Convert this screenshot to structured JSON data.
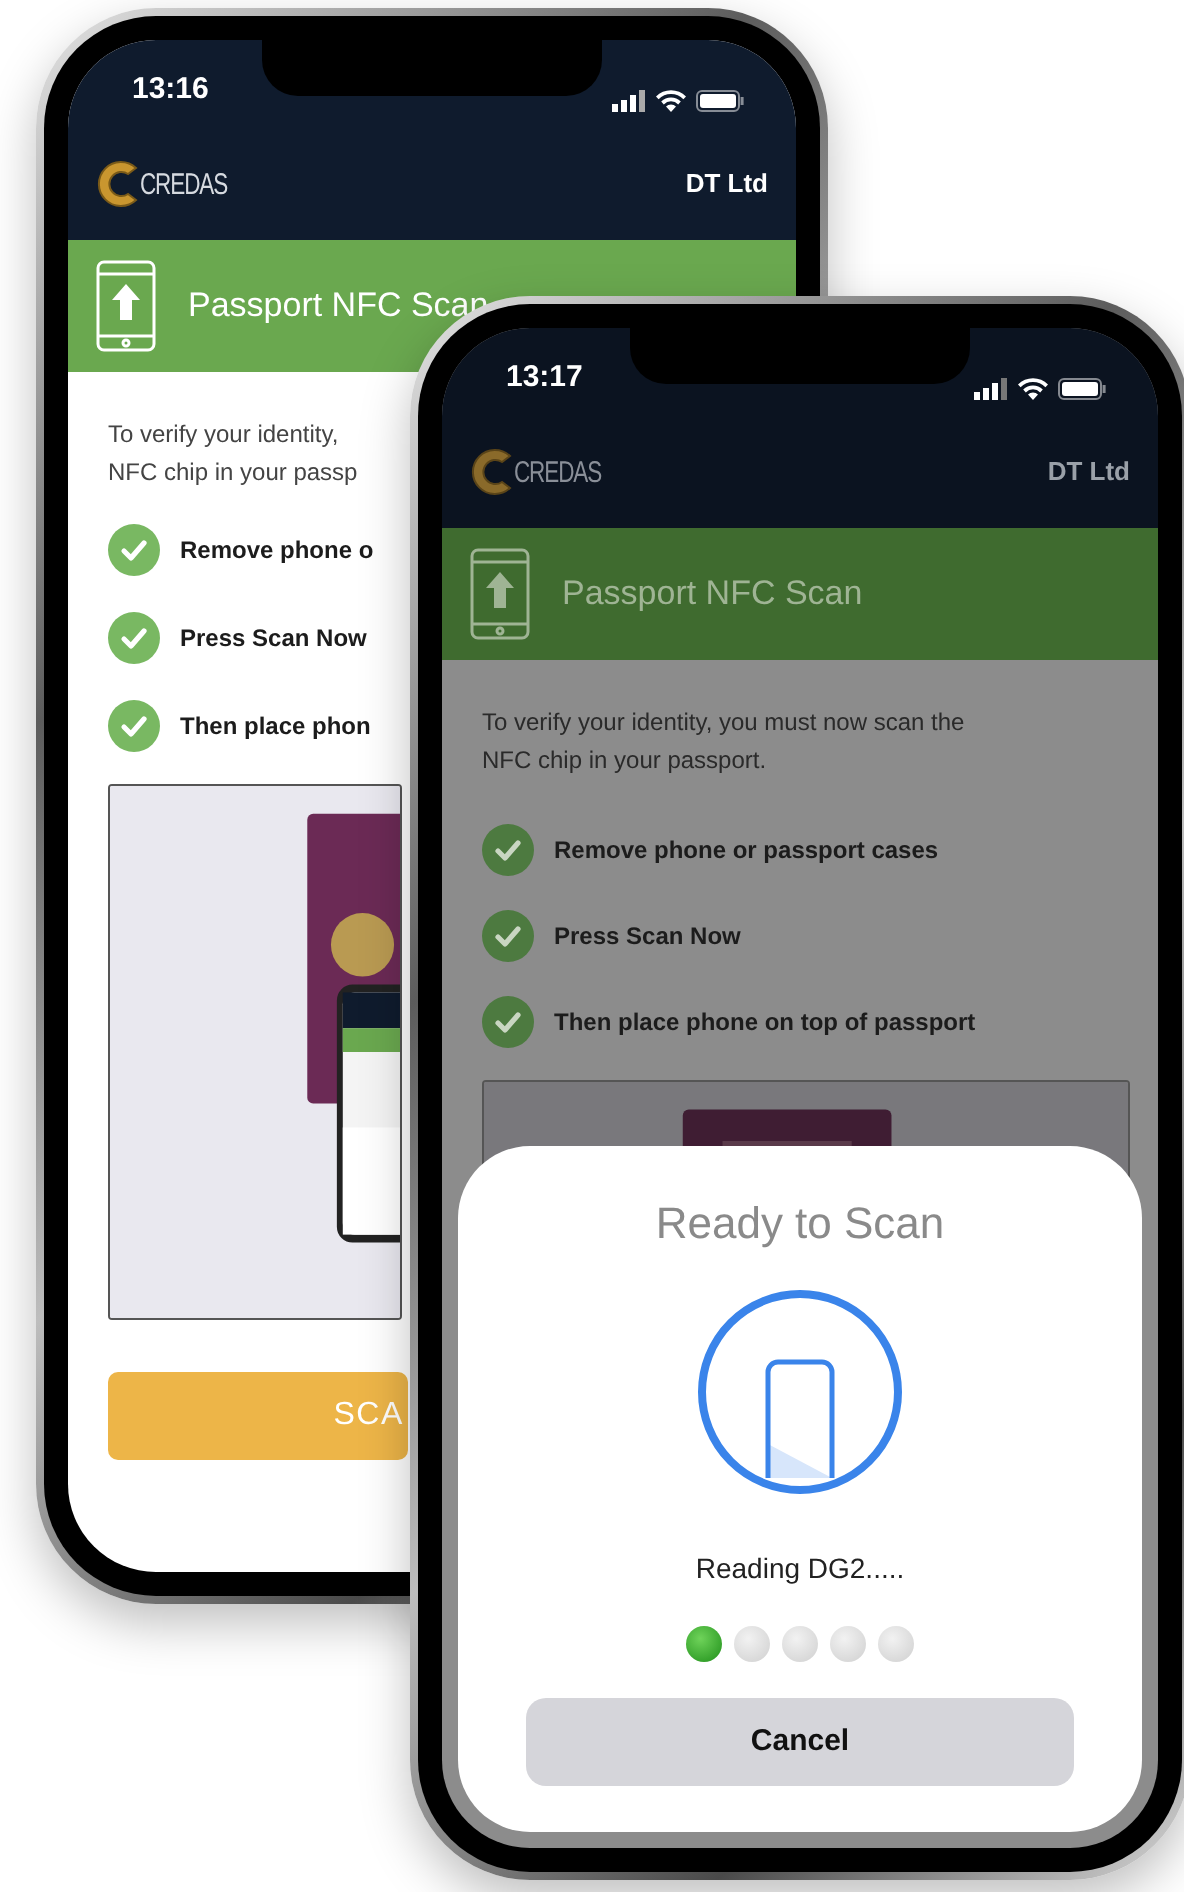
{
  "phones": [
    {
      "status_time": "13:16",
      "brand": "CREDAS",
      "account": "DT Ltd",
      "banner_title": "Passport NFC Scan",
      "intro_lines": [
        "To verify your identity,",
        "NFC chip in your passp"
      ],
      "steps": [
        {
          "text": "Remove phone o",
          "done": true
        },
        {
          "text": "Press Scan Now",
          "done": true
        },
        {
          "text": "Then place phon",
          "done": true
        }
      ],
      "illustration": {
        "kind": "picture"
      },
      "scan_button": "SCA"
    },
    {
      "status_time": "13:17",
      "brand": "CREDAS",
      "account": "DT Ltd",
      "banner_title": "Passport NFC Scan",
      "intro_lines": [
        "To verify your identity, you must now scan the",
        "NFC chip in your passport."
      ],
      "steps": [
        {
          "text": "Remove phone or passport cases",
          "done": true
        },
        {
          "text": "Press Scan Now",
          "done": true
        },
        {
          "text": "Then place phone on top of passport",
          "done": true
        }
      ],
      "illustration": {
        "kind": "picture"
      },
      "sheet": {
        "title": "Ready to Scan",
        "status": "Reading DG2.....",
        "progress_dots": [
          {
            "done": true
          },
          {
            "done": false
          },
          {
            "done": false
          },
          {
            "done": false
          },
          {
            "done": false
          }
        ],
        "cancel": "Cancel"
      }
    }
  ]
}
